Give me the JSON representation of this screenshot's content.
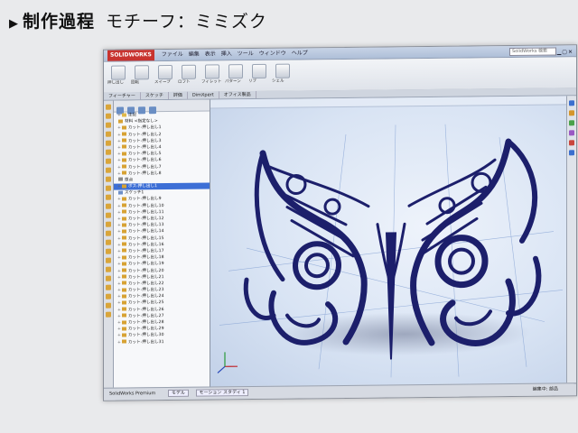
{
  "slide": {
    "title": "制作過程",
    "subtitle": "モチーフ：ミミズク"
  },
  "app": {
    "logo": "SOLIDWORKS",
    "menu": [
      "ファイル",
      "編集",
      "表示",
      "挿入",
      "ツール",
      "ウィンドウ",
      "ヘルプ"
    ],
    "search_placeholder": "SolidWorks 検索"
  },
  "ribbon": {
    "labels": [
      "押し出し",
      "回転",
      "スイープ",
      "ロフト",
      "フィレット",
      "パターン",
      "リブ",
      "シェル"
    ]
  },
  "cmd_tabs": [
    "フィーチャー",
    "スケッチ",
    "評価",
    "DimXpert",
    "オフィス製品"
  ],
  "tree": {
    "items": [
      {
        "label": "注記",
        "kind": "folder",
        "exp": "+"
      },
      {
        "label": "材料 <指定なし>",
        "kind": "feature",
        "exp": ""
      },
      {
        "label": "カット-押し出し1",
        "kind": "feature",
        "exp": "+"
      },
      {
        "label": "カット-押し出し2",
        "kind": "feature",
        "exp": "+"
      },
      {
        "label": "カット-押し出し3",
        "kind": "feature",
        "exp": "+"
      },
      {
        "label": "カット-押し出し4",
        "kind": "feature",
        "exp": "+"
      },
      {
        "label": "カット-押し出し5",
        "kind": "feature",
        "exp": "+"
      },
      {
        "label": "カット-押し出し6",
        "kind": "feature",
        "exp": "+"
      },
      {
        "label": "カット-押し出し7",
        "kind": "feature",
        "exp": "+"
      },
      {
        "label": "カット-押し出し8",
        "kind": "feature",
        "exp": "+"
      },
      {
        "label": "原点",
        "kind": "origin",
        "exp": ""
      },
      {
        "label": "ボス-押し出し1",
        "kind": "feature",
        "exp": "+",
        "selected": true
      },
      {
        "label": "スケッチ1",
        "kind": "sketch",
        "exp": ""
      },
      {
        "label": "カット-押し出し9",
        "kind": "feature",
        "exp": "+"
      },
      {
        "label": "カット-押し出し10",
        "kind": "feature",
        "exp": "+"
      },
      {
        "label": "カット-押し出し11",
        "kind": "feature",
        "exp": "+"
      },
      {
        "label": "カット-押し出し12",
        "kind": "feature",
        "exp": "+"
      },
      {
        "label": "カット-押し出し13",
        "kind": "feature",
        "exp": "+"
      },
      {
        "label": "カット-押し出し14",
        "kind": "feature",
        "exp": "+"
      },
      {
        "label": "カット-押し出し15",
        "kind": "feature",
        "exp": "+"
      },
      {
        "label": "カット-押し出し16",
        "kind": "feature",
        "exp": "+"
      },
      {
        "label": "カット-押し出し17",
        "kind": "feature",
        "exp": "+"
      },
      {
        "label": "カット-押し出し18",
        "kind": "feature",
        "exp": "+"
      },
      {
        "label": "カット-押し出し19",
        "kind": "feature",
        "exp": "+"
      },
      {
        "label": "カット-押し出し20",
        "kind": "feature",
        "exp": "+"
      },
      {
        "label": "カット-押し出し21",
        "kind": "feature",
        "exp": "+"
      },
      {
        "label": "カット-押し出し22",
        "kind": "feature",
        "exp": "+"
      },
      {
        "label": "カット-押し出し23",
        "kind": "feature",
        "exp": "+"
      },
      {
        "label": "カット-押し出し24",
        "kind": "feature",
        "exp": "+"
      },
      {
        "label": "カット-押し出し25",
        "kind": "feature",
        "exp": "+"
      },
      {
        "label": "カット-押し出し26",
        "kind": "feature",
        "exp": "+"
      },
      {
        "label": "カット-押し出し27",
        "kind": "feature",
        "exp": "+"
      },
      {
        "label": "カット-押し出し28",
        "kind": "feature",
        "exp": "+"
      },
      {
        "label": "カット-押し出し29",
        "kind": "feature",
        "exp": "+"
      },
      {
        "label": "カット-押し出し30",
        "kind": "feature",
        "exp": "+"
      },
      {
        "label": "カット-押し出し31",
        "kind": "feature",
        "exp": "+"
      }
    ]
  },
  "status": {
    "left": "SolidWorks Premium",
    "tabs": [
      "モデル",
      "モーション スタディ 1"
    ],
    "right": "編集中: 部品"
  },
  "colors": {
    "model": "#1c1f6b",
    "viewport_bg": "#dfe8f5",
    "selection": "#3d6fd6"
  }
}
